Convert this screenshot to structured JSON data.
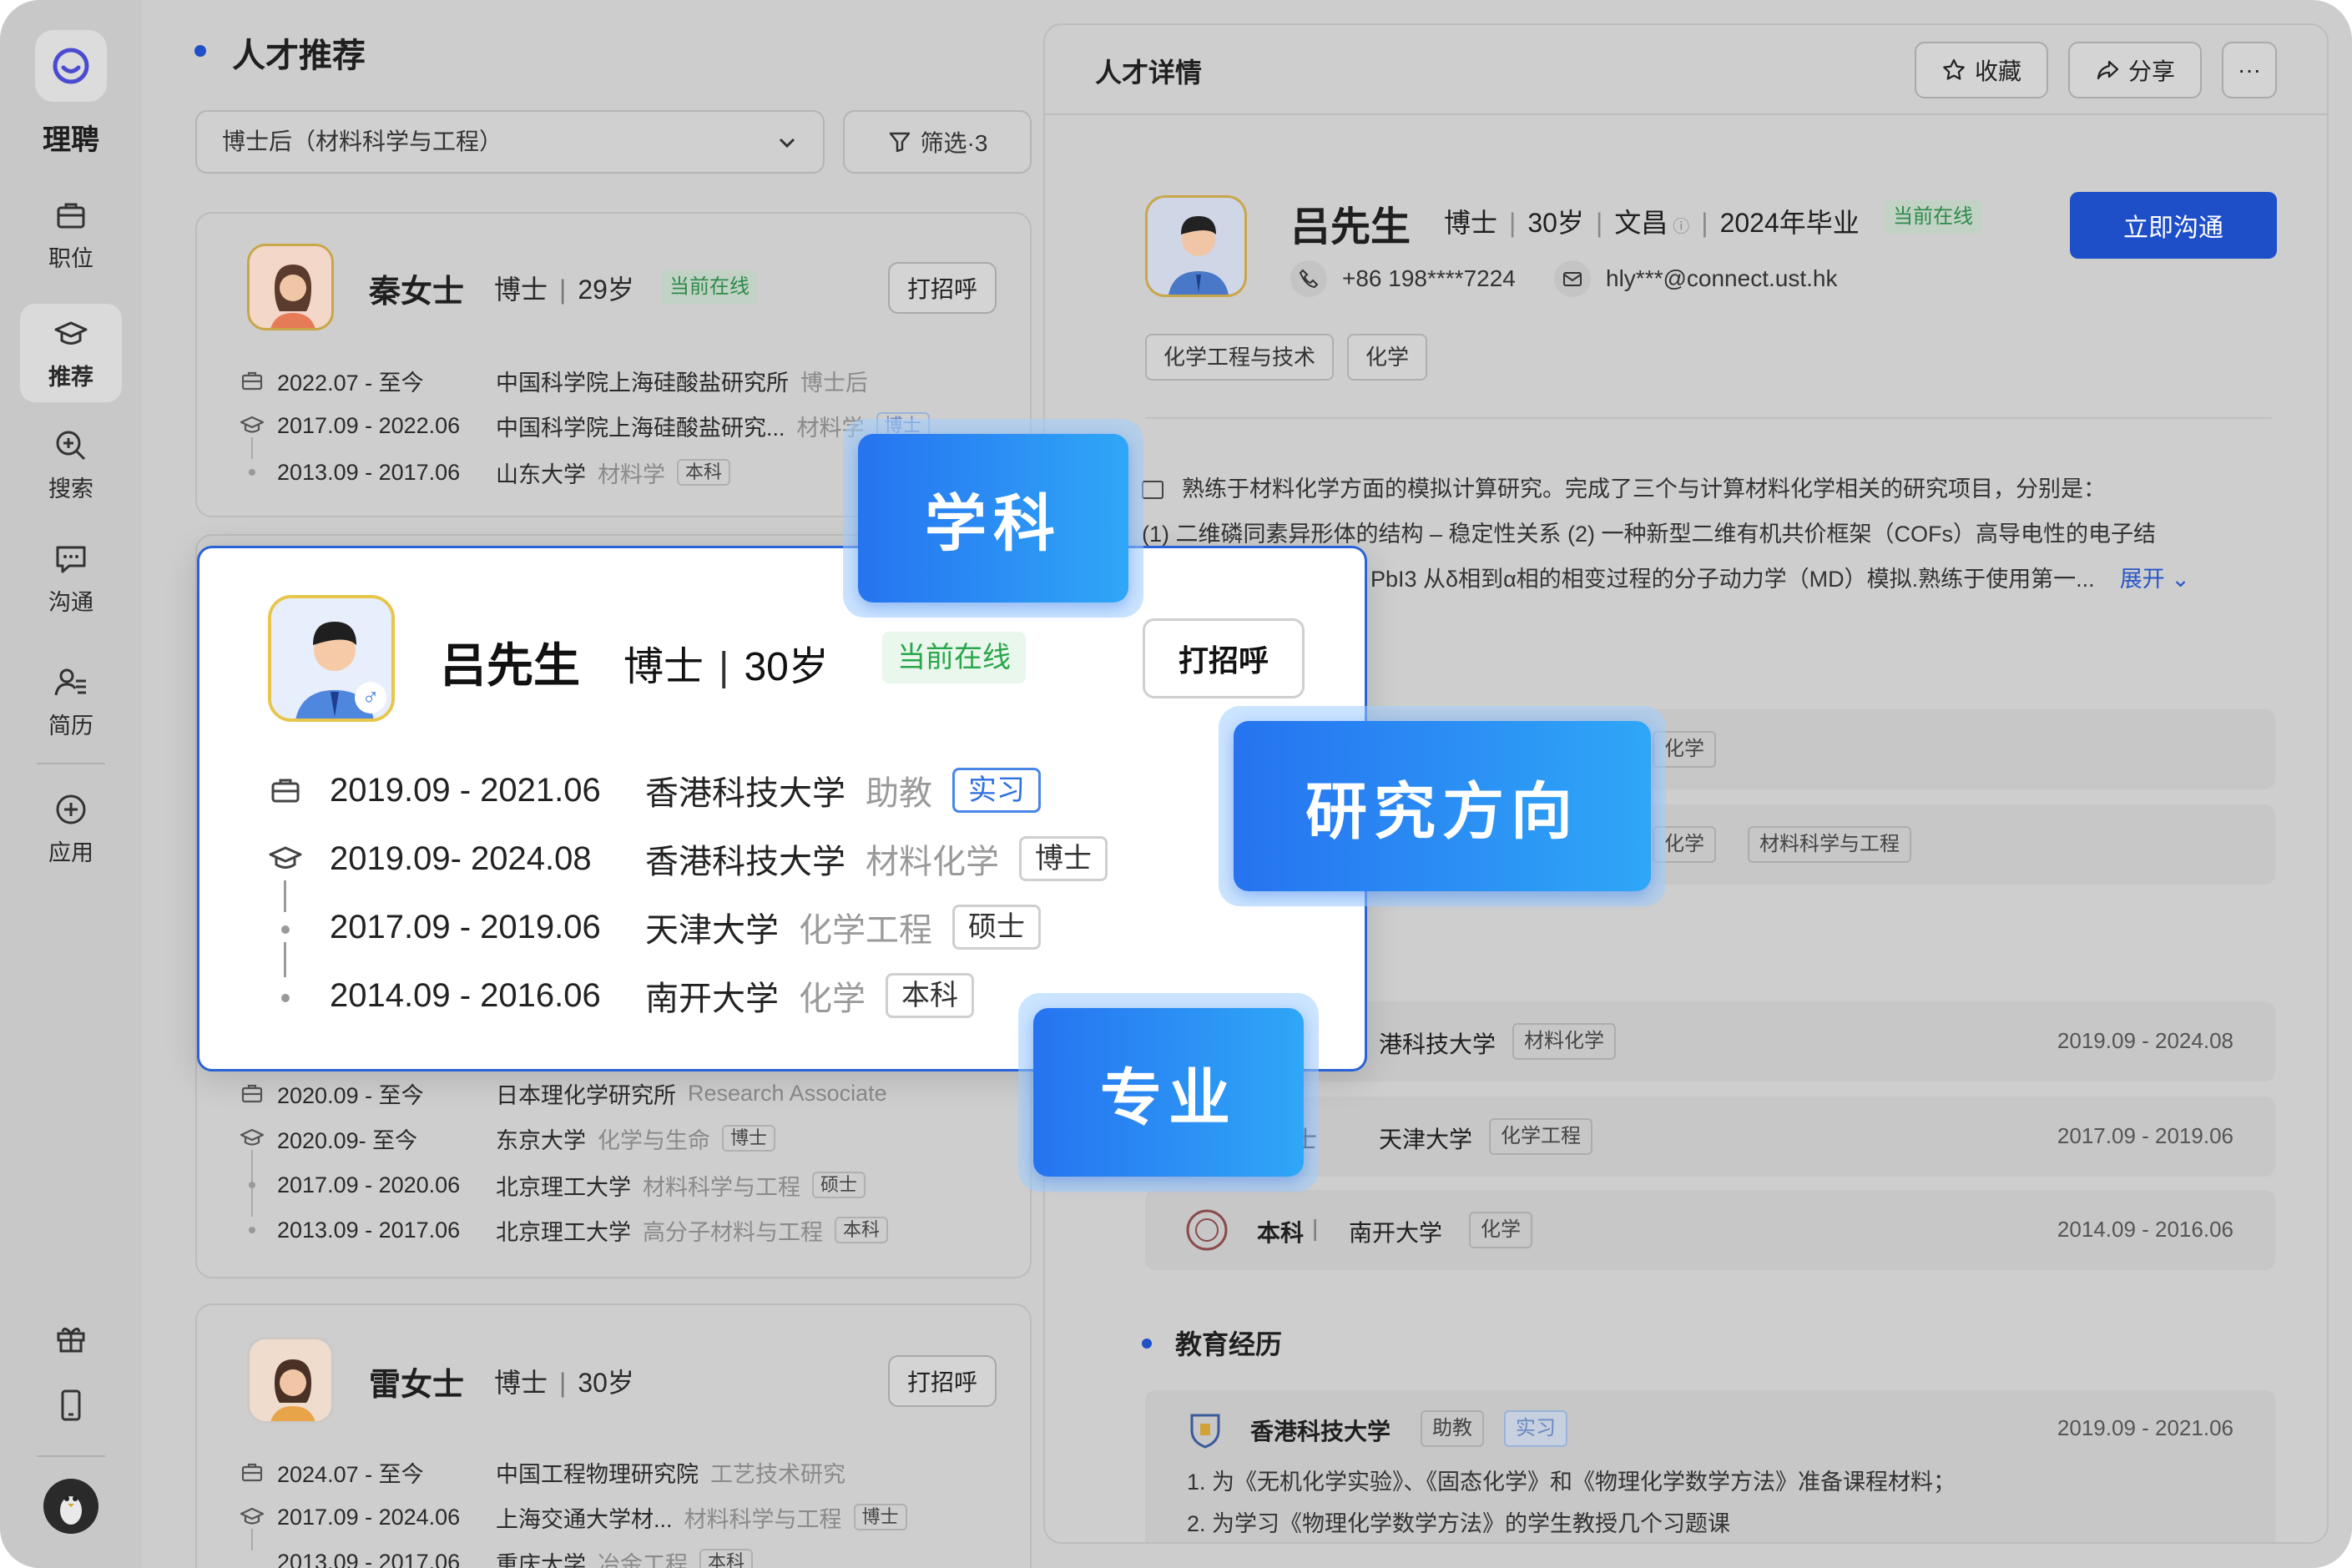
{
  "brand": {
    "name": "理聘"
  },
  "nav": [
    {
      "label": "职位"
    },
    {
      "label": "推荐"
    },
    {
      "label": "搜索"
    },
    {
      "label": "沟通"
    },
    {
      "label": "简历"
    },
    {
      "label": "应用"
    }
  ],
  "left": {
    "title": "人才推荐",
    "select_value": "博士后（材料科学与工程）",
    "filter_label": "筛选·3",
    "cards": [
      {
        "name": "秦女士",
        "degree": "博士",
        "age": "29岁",
        "online": "当前在线",
        "greet": "打招呼",
        "rows": [
          {
            "date": "2022.07 - 至今",
            "org": "中国科学院上海硅酸盐研究所",
            "sub": "博士后",
            "tag": ""
          },
          {
            "date": "2017.09 - 2022.06",
            "org": "中国科学院上海硅酸盐研究...",
            "sub": "材料学",
            "tag": "博士"
          },
          {
            "date": "2013.09 - 2017.06",
            "org": "山东大学",
            "sub": "材料学",
            "tag": "本科"
          }
        ]
      },
      {
        "rows": [
          {
            "date": "2020.09 - 至今",
            "org": "日本理化学研究所",
            "sub": "Research Associate",
            "tag": ""
          },
          {
            "date": "2020.09- 至今",
            "org": "东京大学",
            "sub": "化学与生命",
            "tag": "博士"
          },
          {
            "date": "2017.09 - 2020.06",
            "org": "北京理工大学",
            "sub": "材料科学与工程",
            "tag": "硕士"
          },
          {
            "date": "2013.09 - 2017.06",
            "org": "北京理工大学",
            "sub": "高分子材料与工程",
            "tag": "本科"
          }
        ]
      },
      {
        "name": "雷女士",
        "degree": "博士",
        "age": "30岁",
        "greet": "打招呼",
        "rows": [
          {
            "date": "2024.07 - 至今",
            "org": "中国工程物理研究院",
            "sub": "工艺技术研究",
            "tag": ""
          },
          {
            "date": "2017.09 - 2024.06",
            "org": "上海交通大学材...",
            "sub": "材料科学与工程",
            "tag": "博士"
          },
          {
            "date": "2013.09 - 2017.06",
            "org": "重庆大学",
            "sub": "冶金工程",
            "tag": "本科"
          }
        ]
      }
    ]
  },
  "detail": {
    "title": "人才详情",
    "fav": "收藏",
    "share": "分享",
    "more": "···",
    "name": "吕先生",
    "degree": "博士",
    "age": "30岁",
    "field": "文昌",
    "grad": "2024年毕业",
    "online": "当前在线",
    "phone": "+86 198****7224",
    "email": "hly***@connect.ust.hk",
    "go": "立即沟通",
    "tags": [
      "化学工程与技术",
      "化学"
    ],
    "desc1": "熟练于材料化学方面的模拟计算研究。完成了三个与计算材料化学相关的研究项目，分别是：",
    "desc2": "(1)  二维磷同素异形体的结构 – 稳定性关系 (2) 一种新型二维有机共价框架（COFs）高导电性的电子结",
    "desc3": "PbI3 从δ相到α相的相变过程的分子动力学（MD）模拟.熟练于使用第一...",
    "expand": "展开",
    "dir_tags1": [
      "化学"
    ],
    "dir_tags2": [
      "化学",
      "材料科学与工程"
    ],
    "edu": [
      {
        "school": "港科技大学",
        "major": "材料化学",
        "date": "2019.09 - 2024.08"
      },
      {
        "deg": "士",
        "school": "天津大学",
        "major": "化学工程",
        "date": "2017.09 - 2019.06"
      },
      {
        "deg": "本科",
        "school": "南开大学",
        "major": "化学",
        "date": "2014.09 - 2016.06"
      }
    ],
    "sec_title": "教育经历",
    "exp": {
      "school": "香港科技大学",
      "role": "助教",
      "tag": "实习",
      "date": "2019.09 - 2021.06",
      "li1": "1.    为《无机化学实验》、《固态化学》和《物理化学数学方法》准备课程材料；",
      "li2": "2.    为学习《物理化学数学方法》的学生教授几个习题课"
    }
  },
  "popup": {
    "name": "吕先生",
    "degree": "博士",
    "age": "30岁",
    "online": "当前在线",
    "greet": "打招呼",
    "rows": [
      {
        "date": "2019.09 - 2021.06",
        "org": "香港科技大学",
        "sub": "助教",
        "tag": "实习"
      },
      {
        "date": "2019.09- 2024.08",
        "org": "香港科技大学",
        "sub": "材料化学",
        "tag": "博士"
      },
      {
        "date": "2017.09 - 2019.06",
        "org": "天津大学",
        "sub": "化学工程",
        "tag": "硕士"
      },
      {
        "date": "2014.09 - 2016.06",
        "org": "南开大学",
        "sub": "化学",
        "tag": "本科"
      }
    ]
  },
  "callouts": {
    "subject": "学科",
    "direction": "研究方向",
    "major": "专业"
  },
  "colors": {
    "accent": "#1e4fc9",
    "online": "#2aa64b",
    "callout": "#2673f0"
  }
}
